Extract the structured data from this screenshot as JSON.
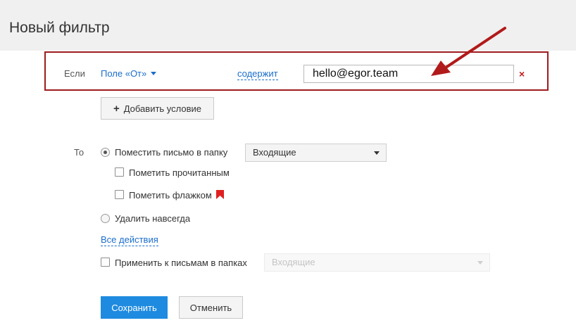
{
  "header": {
    "title": "Новый фильтр"
  },
  "condition": {
    "if_label": "Если",
    "field_label": "Поле «От»",
    "operator_label": "содержит",
    "value": "hello@egor.team",
    "remove_label": "×"
  },
  "add_condition_label": "Добавить условие",
  "actions": {
    "to_label": "То",
    "move_to_folder_label": "Поместить письмо в папку",
    "move_to_folder_selected": true,
    "folder_value": "Входящие",
    "mark_read_label": "Пометить прочитанным",
    "mark_read_checked": false,
    "mark_flag_label": "Пометить флажком",
    "mark_flag_checked": false,
    "delete_forever_label": "Удалить навсегда",
    "delete_forever_selected": false,
    "all_actions_label": "Все действия"
  },
  "apply_to_existing": {
    "label": "Применить к письмам в папках",
    "checked": false,
    "folder_value": "Входящие",
    "folder_disabled": true
  },
  "buttons": {
    "save_label": "Сохранить",
    "cancel_label": "Отменить"
  },
  "colors": {
    "accent_link": "#1a6dcc",
    "highlight_box": "#9e1b1e",
    "annotation_arrow": "#b11a1a",
    "primary_button": "#1e8be0",
    "flag": "#e02020",
    "remove_x": "#c31b1b"
  },
  "icons": {
    "remove": "close-icon",
    "add": "plus-icon",
    "flag": "flag-icon",
    "dropdown": "chevron-down-icon"
  }
}
